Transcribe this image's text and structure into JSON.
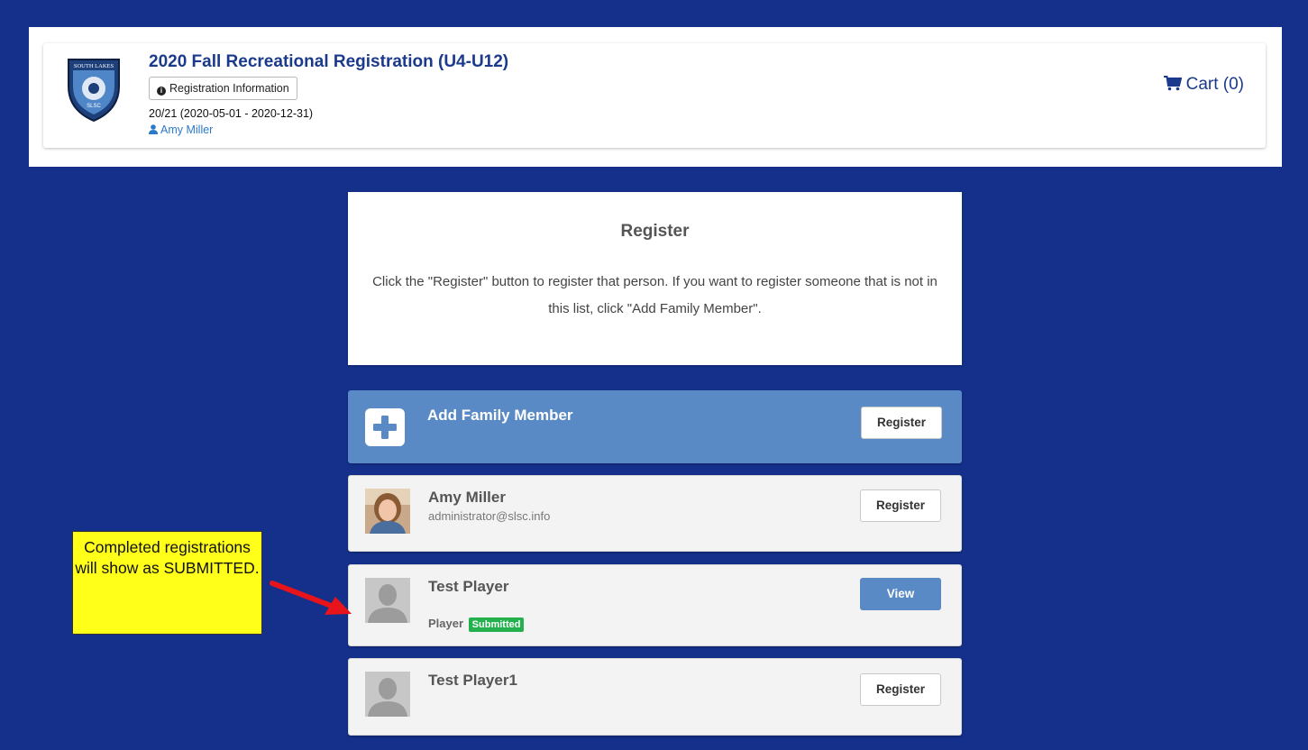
{
  "header": {
    "title": "2020 Fall Recreational Registration (U4-U12)",
    "info_button": "Registration Information",
    "season": "20/21 (2020-05-01 - 2020-12-31)",
    "user": "Amy Miller",
    "cart": "Cart (0)",
    "logo": {
      "top_text": "SOUTH LAKES",
      "center_text": "SLSC"
    }
  },
  "register_panel": {
    "heading": "Register",
    "instructions": "Click the \"Register\" button to register that person. If you want to register someone that is not in this list, click \"Add Family Member\"."
  },
  "add_family": {
    "label": "Add Family Member",
    "button": "Register"
  },
  "people": [
    {
      "name": "Amy Miller",
      "email": "administrator@slsc.info",
      "button": "Register"
    },
    {
      "name": "Test Player",
      "role": "Player",
      "status": "Submitted",
      "button": "View"
    },
    {
      "name": "Test Player1",
      "button": "Register"
    }
  ],
  "callout": {
    "text": "Completed registrations will show as SUBMITTED."
  },
  "colors": {
    "background": "#14308a",
    "accent": "#5a8ac6",
    "title": "#1b3a8c",
    "submitted": "#22b14c",
    "callout": "#ffff1a",
    "arrow": "#e8141b"
  }
}
